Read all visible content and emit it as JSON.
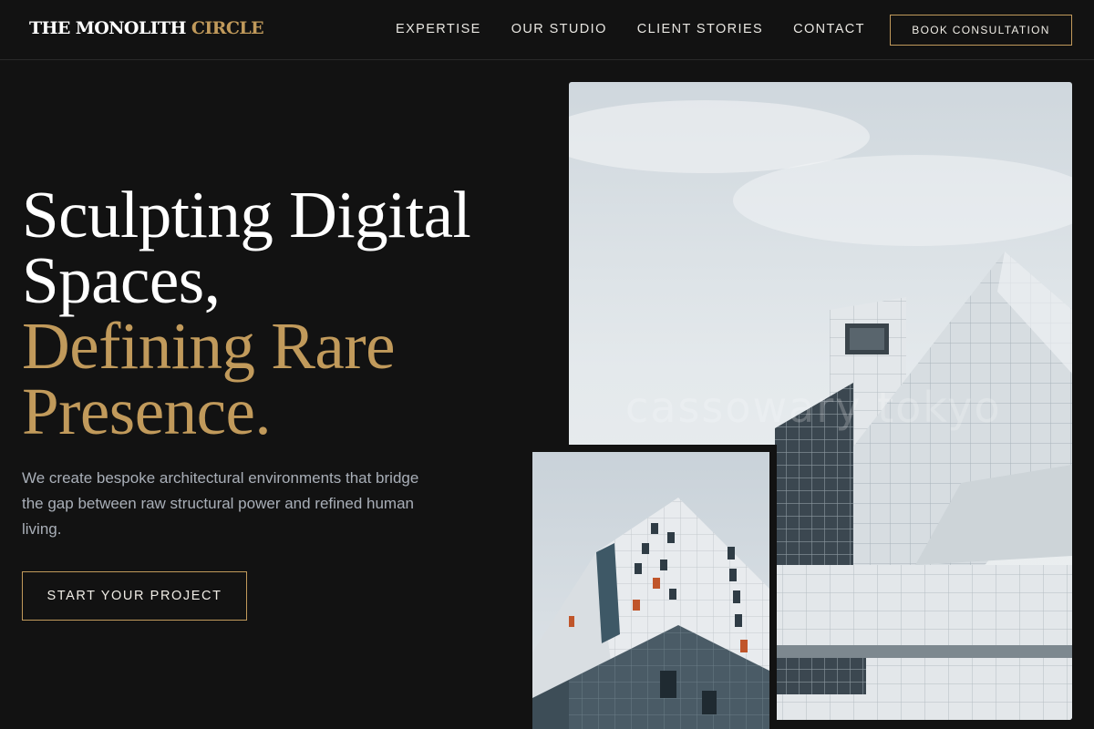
{
  "header": {
    "logo_main": "THE MONOLITH",
    "logo_accent": "CIRCLE",
    "nav": [
      "EXPERTISE",
      "OUR STUDIO",
      "CLIENT STORIES",
      "CONTACT"
    ],
    "cta_label": "BOOK CONSULTATION"
  },
  "hero": {
    "headline_lines": [
      "Sculpting Digital",
      "Spaces,",
      "Defining Rare",
      "Presence."
    ],
    "subtext": "We create bespoke architectural environments that bridge the gap between raw structural power and refined human living.",
    "cta_label": "START YOUR PROJECT"
  },
  "images": {
    "large_watermark": "cassowary tokyo"
  },
  "colors": {
    "background": "#121212",
    "accent_gold": "#c19a5b",
    "text_light": "#f4f1ea",
    "text_muted": "#a9afb8"
  }
}
